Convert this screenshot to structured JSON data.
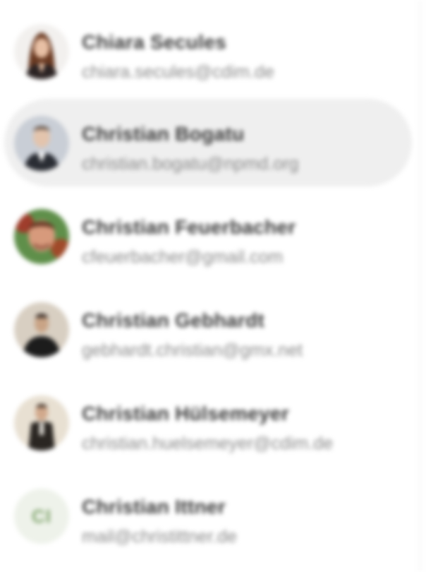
{
  "contacts": [
    {
      "name": "Chiara Secules",
      "email": "chiara.secules@cdim.de",
      "avatar": "photo",
      "avatar_icon": "person-photo-icon",
      "highlighted": false
    },
    {
      "name": "Christian Bogatu",
      "email": "christian.bogatu@npmd.org",
      "avatar": "photo",
      "avatar_icon": "person-photo-icon",
      "highlighted": true
    },
    {
      "name": "Christian Feuerbacher",
      "email": "cfeuerbacher@gmail.com",
      "avatar": "photo",
      "avatar_icon": "person-photo-icon",
      "highlighted": false
    },
    {
      "name": "Christian Gebhardt",
      "email": "gebhardt.christian@gmx.net",
      "avatar": "photo",
      "avatar_icon": "person-photo-icon",
      "highlighted": false
    },
    {
      "name": "Christian Hülsemeyer",
      "email": "christian.huelsemeyer@cdim.de",
      "avatar": "photo",
      "avatar_icon": "person-photo-icon",
      "highlighted": false
    },
    {
      "name": "Christian Ittner",
      "email": "mail@christittner.de",
      "avatar": "initials",
      "initials": "CI",
      "highlighted": false
    }
  ],
  "colors": {
    "highlight_bg": "#efefef",
    "name_text": "#3a3a3a",
    "email_text": "#8a8a8a",
    "initials_bg": "#eef2ea",
    "initials_fg": "#7ea36a"
  }
}
